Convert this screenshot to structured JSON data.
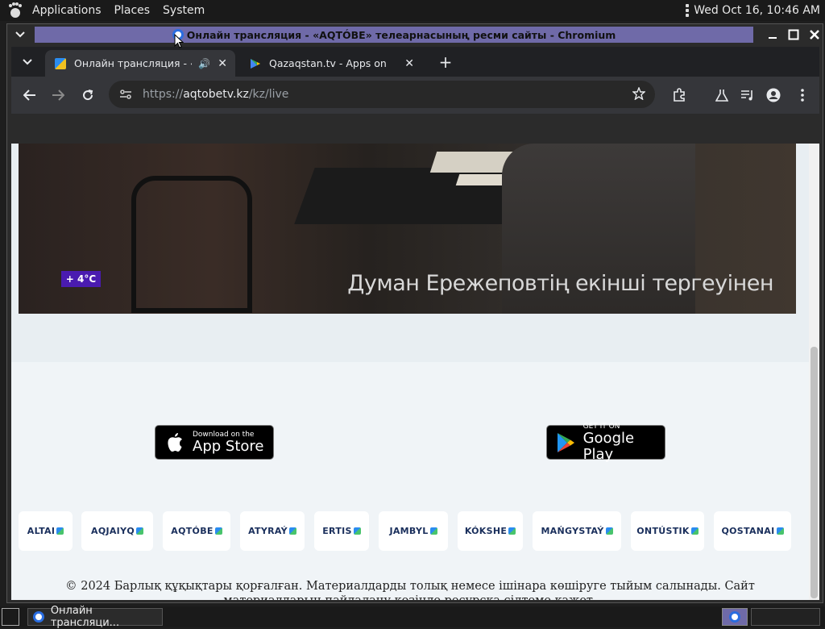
{
  "top_panel": {
    "menu": [
      "Applications",
      "Places",
      "System"
    ],
    "clock": "Wed Oct 16, 10:46 AM"
  },
  "window": {
    "title": "Онлайн трансляция - «AQTÓBE» телеарнасының ресми сайты - Chromium"
  },
  "tabs": [
    {
      "title": "Онлайн трансляция - «A",
      "active": true,
      "audio": true
    },
    {
      "title": "Qazaqstan.tv - Apps on Goo",
      "active": false
    }
  ],
  "toolbar": {
    "url_prefix": "https://",
    "url_domain": "aqtobetv.kz",
    "url_path": "/kz/live"
  },
  "video": {
    "temperature": "+ 4°C",
    "subtitle": "Думан Ережеповтің екінші тергеуінен"
  },
  "stores": {
    "apple_small": "Download on the",
    "apple_big": "App Store",
    "google_small": "GET IT ON",
    "google_big": "Google Play"
  },
  "regions": [
    "ALTAI",
    "AQJAIYQ",
    "AQTÓBE",
    "ATYRAÝ",
    "ERTIS",
    "JAMBYL",
    "KÓKSHE",
    "MAŃGYSTAÝ",
    "ONTÚSTIK",
    "QOSTANAI"
  ],
  "footer": {
    "copyright": "© 2024 Барлық құқықтары қорғалған. Материалдарды толық немесе ішінара көшіруге тыйым салынады. Сайт материалдарын пайдалану кезінде ресурсқа сілтеме қажет."
  },
  "taskbar": {
    "window_button": "Онлайн трансляци..."
  },
  "colors": {
    "title_highlight": "#6f6aa8",
    "temp_badge": "#4a1bb0",
    "region_text": "#1a2f5c"
  }
}
